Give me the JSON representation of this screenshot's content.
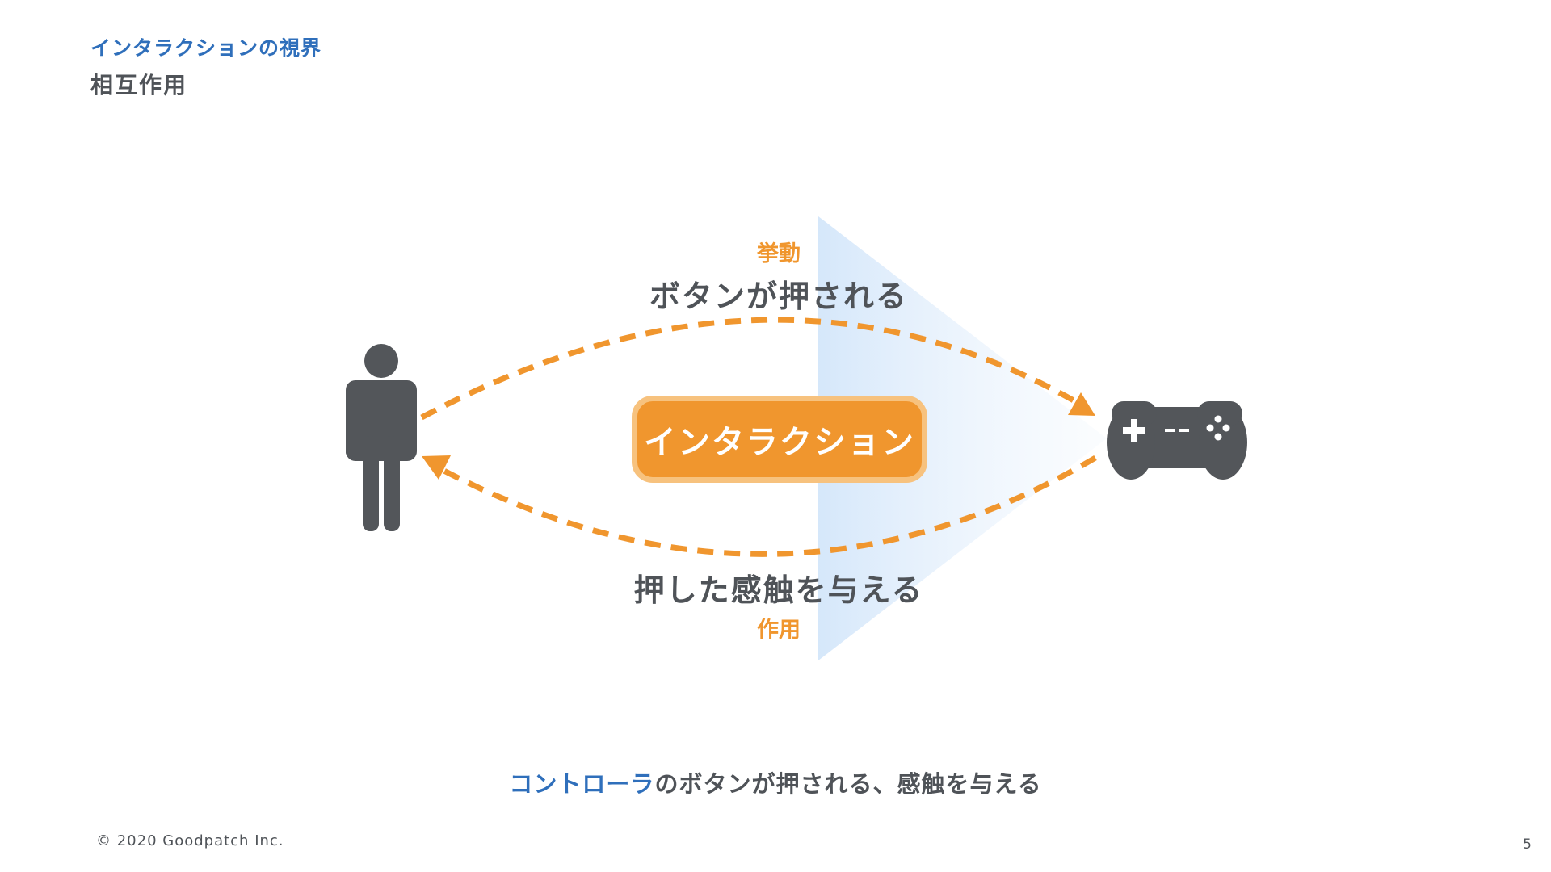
{
  "header": {
    "kicker": "インタラクションの視界",
    "title": "相互作用"
  },
  "diagram": {
    "top_tag": "挙動",
    "top_label": "ボタンが押される",
    "center_label": "インタラクション",
    "bottom_label": "押した感触を与える",
    "bottom_tag": "作用",
    "left_icon": "person-icon",
    "right_icon": "game-controller-icon"
  },
  "caption": {
    "accent": "コントローラ",
    "rest": "のボタンが押される、感触を与える"
  },
  "footer": {
    "copyright": "© 2020 Goodpatch Inc.",
    "page_number": "5"
  },
  "colors": {
    "accent_orange": "#f0962e",
    "accent_blue": "#2f6fbb",
    "icon_gray": "#53565a",
    "text_gray": "#4f5358"
  }
}
